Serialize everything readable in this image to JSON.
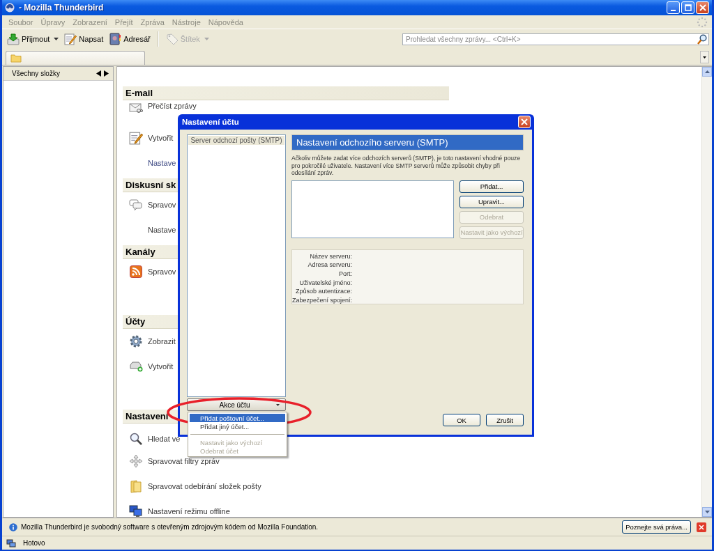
{
  "window": {
    "title": "- Mozilla Thunderbird"
  },
  "menu_bar": [
    "Soubor",
    "Úpravy",
    "Zobrazení",
    "Přejít",
    "Zpráva",
    "Nástroje",
    "Nápověda"
  ],
  "toolbar": [
    {
      "label": "Přijmout",
      "kind": "receive",
      "dropdown": true,
      "disabled": false
    },
    {
      "label": "Napsat",
      "kind": "compose",
      "dropdown": false,
      "disabled": false
    },
    {
      "label": "Adresář",
      "kind": "addressbook",
      "dropdown": false,
      "disabled": false
    },
    {
      "label": "Štítek",
      "kind": "tag",
      "dropdown": true,
      "disabled": true
    }
  ],
  "search": {
    "placeholder": "Prohledat všechny zprávy... <Ctrl+K>"
  },
  "folder_pane": {
    "title": "Všechny složky"
  },
  "sections": [
    {
      "heading": "E-mail",
      "items": [
        {
          "label": "Přečíst zprávy",
          "kind": "mail"
        },
        {
          "label": "Vytvořit",
          "kind": "compose"
        },
        {
          "label": "Nastave",
          "kind": "link"
        }
      ]
    },
    {
      "heading": "Diskusní sk",
      "items": [
        {
          "label": "Spravov",
          "kind": "chat"
        },
        {
          "label": "Nastave",
          "kind": "plain"
        }
      ]
    },
    {
      "heading": "Kanály",
      "items": [
        {
          "label": "Spravov",
          "kind": "rss"
        }
      ]
    },
    {
      "heading": "Účty",
      "items": [
        {
          "label": "Zobrazit",
          "kind": "gear"
        },
        {
          "label": "Vytvořit",
          "kind": "newaccount"
        }
      ]
    },
    {
      "heading": "Nastavení",
      "items": [
        {
          "label": "Hledat ve",
          "kind": "search"
        },
        {
          "label": "Spravovat filtry zpráv",
          "kind": "filter"
        },
        {
          "label": "Spravovat odebírání složek pošty",
          "kind": "folder"
        },
        {
          "label": "Nastavení režimu offline",
          "kind": "offline"
        }
      ]
    }
  ],
  "dialog": {
    "title": "Nastavení účtu",
    "account_list": [
      {
        "label": "Server odchozí pošty (SMTP)",
        "selected": true
      }
    ],
    "account_actions": "Akce účtu",
    "panel_title": "Nastavení odchozího serveru (SMTP)",
    "description": "Ačkoliv můžete zadat více odchozích serverů (SMTP), je toto nastavení vhodné pouze pro pokročilé uživatele. Nastavení více SMTP serverů může způsobit chyby při odesílání zpráv.",
    "server_buttons": [
      {
        "label": "Přidat...",
        "disabled": false
      },
      {
        "label": "Upravit...",
        "disabled": false
      },
      {
        "label": "Odebrat",
        "disabled": true
      },
      {
        "label": "Nastavit jako výchozí",
        "disabled": true
      }
    ],
    "server_details": [
      "Název serveru:",
      "Adresa serveru:",
      "Port:",
      "Uživatelské jméno:",
      "Způsob autentizace:",
      "Zabezpečení spojení:"
    ],
    "buttons": [
      "OK",
      "Zrušit"
    ]
  },
  "actions_menu": [
    {
      "kind": "item",
      "label": "Přidat poštovní účet...",
      "selected": true,
      "disabled": false
    },
    {
      "kind": "item",
      "label": "Přidat jiný účet...",
      "selected": false,
      "disabled": false
    },
    {
      "kind": "separator"
    },
    {
      "kind": "item",
      "label": "Nastavit jako výchozí",
      "selected": false,
      "disabled": true
    },
    {
      "kind": "item",
      "label": "Odebrat účet",
      "selected": false,
      "disabled": true
    }
  ],
  "notification": {
    "text": "Mozilla Thunderbird je svobodný software s otevřeným zdrojovým kódem od Mozilla Foundation.",
    "button": "Poznejte svá práva..."
  },
  "status_bar": {
    "text": "Hotovo"
  }
}
